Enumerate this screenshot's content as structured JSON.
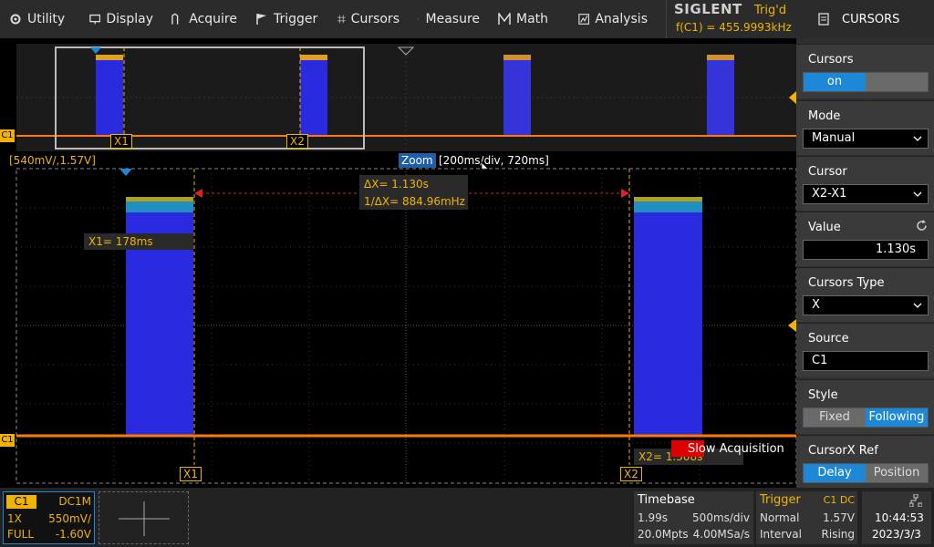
{
  "menu": [
    {
      "label": "Utility",
      "icon": "gear-icon"
    },
    {
      "label": "Display",
      "icon": "monitor-icon"
    },
    {
      "label": "Acquire",
      "icon": "acquire-icon"
    },
    {
      "label": "Trigger",
      "icon": "flag-icon"
    },
    {
      "label": "Cursors",
      "icon": "crosshair-icon"
    },
    {
      "label": "Measure",
      "icon": "measure-icon"
    },
    {
      "label": "Math",
      "icon": "math-icon"
    },
    {
      "label": "Analysis",
      "icon": "analysis-icon"
    }
  ],
  "brand": {
    "name": "SIGLENT",
    "trig_state": "Trig'd",
    "freq": "f(C1) = 455.9993kHz"
  },
  "panel": {
    "title": "CURSORS",
    "cursors": {
      "label": "Cursors",
      "on": "on"
    },
    "mode": {
      "label": "Mode",
      "value": "Manual"
    },
    "cursor": {
      "label": "Cursor",
      "value": "X2-X1"
    },
    "value": {
      "label": "Value",
      "value": "1.130s"
    },
    "type": {
      "label": "Cursors Type",
      "value": "X"
    },
    "source": {
      "label": "Source",
      "value": "C1"
    },
    "style": {
      "label": "Style",
      "fixed": "Fixed",
      "following": "Following"
    },
    "ref": {
      "label": "CursorX Ref",
      "delay": "Delay",
      "position": "Position"
    }
  },
  "overview": {
    "x1": "X1",
    "x2": "X2",
    "ch": "C1"
  },
  "scale_label": "[540mV/,1.57V]",
  "zoom": {
    "label": "Zoom",
    "info": "[200ms/div, 720ms]"
  },
  "measure": {
    "dx": "ΔX= 1.130s",
    "inv_dx": "1/ΔX= 884.96mHz",
    "x1": "X1= 178ms",
    "x2": "X2= 1.308s"
  },
  "grid": {
    "x1": "X1",
    "x2": "X2",
    "ch": "C1"
  },
  "slow_acq": "Slow Acquisition",
  "channel": {
    "name": "C1",
    "coupling": "DC1M",
    "probe": "1X",
    "scale": "550mV/",
    "bw": "FULL",
    "offset": "-1.60V"
  },
  "timebase": {
    "label": "Timebase",
    "delay": "1.99s",
    "scale": "500ms/div",
    "pts": "20.0Mpts",
    "rate": "4.00MSa/s"
  },
  "trigger": {
    "label": "Trigger",
    "src": "C1 DC",
    "mode": "Normal",
    "level": "1.57V",
    "type": "Interval",
    "slope": "Rising"
  },
  "clock": {
    "time": "10:44:53",
    "date": "2023/3/3"
  },
  "colors": {
    "accent": "#f0b400",
    "blue": "#1e88d8",
    "wave": "#2a2ae0",
    "trace": "#ff7a00"
  }
}
